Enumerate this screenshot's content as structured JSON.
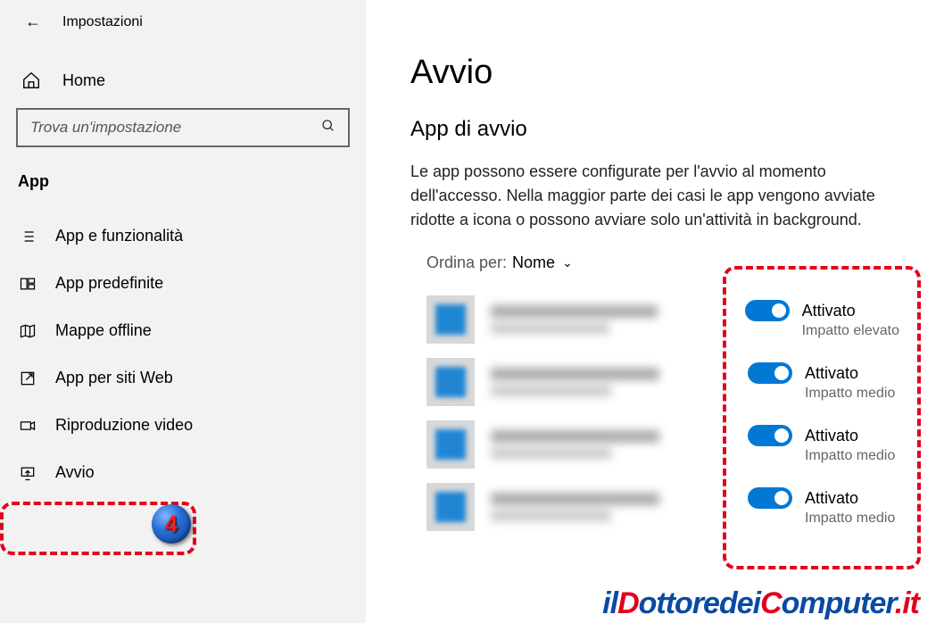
{
  "header": {
    "title": "Impostazioni"
  },
  "sidebar": {
    "home": "Home",
    "search_placeholder": "Trova un'impostazione",
    "section": "App",
    "items": [
      {
        "label": "App e funzionalità"
      },
      {
        "label": "App predefinite"
      },
      {
        "label": "Mappe offline"
      },
      {
        "label": "App per siti Web"
      },
      {
        "label": "Riproduzione video"
      },
      {
        "label": "Avvio"
      }
    ]
  },
  "main": {
    "title": "Avvio",
    "subtitle": "App di avvio",
    "description": "Le app possono essere configurate per l'avvio al momento dell'accesso. Nella maggior parte dei casi le app vengono avviate ridotte a icona o possono avviare solo un'attività in background.",
    "sort_label": "Ordina per:",
    "sort_value": "Nome",
    "items": [
      {
        "status": "Attivato",
        "impact": "Impatto elevato"
      },
      {
        "status": "Attivato",
        "impact": "Impatto medio"
      },
      {
        "status": "Attivato",
        "impact": "Impatto medio"
      },
      {
        "status": "Attivato",
        "impact": "Impatto medio"
      }
    ]
  },
  "annotation": {
    "badge": "4"
  },
  "watermark": {
    "p1": "il",
    "p2": "D",
    "p3": "ottoredei",
    "p4": "C",
    "p5": "omputer",
    "p6": ".it"
  }
}
